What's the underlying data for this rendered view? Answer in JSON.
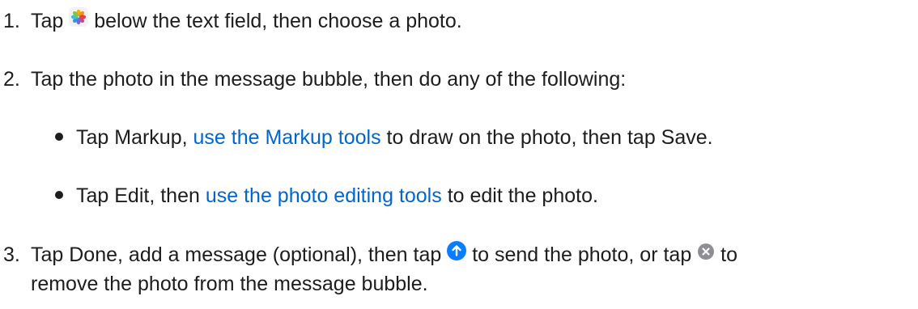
{
  "steps": [
    {
      "number": "1.",
      "before_icon": "Tap",
      "icon": "photos-app-icon",
      "after_icon": "below the text field, then choose a photo."
    },
    {
      "number": "2.",
      "text": "Tap the photo in the message bubble, then do any of the following:"
    },
    {
      "number": "3.",
      "part1": "Tap Done, add a message (optional), then tap",
      "icon1": "send-arrow-icon",
      "part2": "to send the photo, or tap",
      "icon2": "remove-x-icon",
      "part3": "to",
      "line2": "remove the photo from the message bubble."
    }
  ],
  "bullets": [
    {
      "before": "Tap Markup,",
      "link": "use the Markup tools",
      "after": "to draw on the photo, then tap Save."
    },
    {
      "before": "Tap Edit, then",
      "link": "use the photo editing tools",
      "after": "to edit the photo."
    }
  ],
  "colors": {
    "text": "#1d1d1f",
    "link": "#0066cc",
    "send_icon": "#0a7cff",
    "remove_icon": "#8e8e93"
  }
}
